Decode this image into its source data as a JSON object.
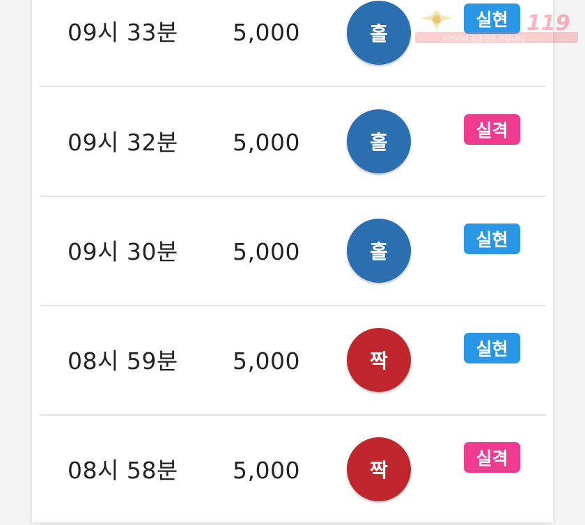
{
  "rows": [
    {
      "time": "09시 33분",
      "amount": "5,000",
      "result": "홀",
      "result_type": "odd",
      "status": "실현",
      "status_type": "hit"
    },
    {
      "time": "09시 32분",
      "amount": "5,000",
      "result": "홀",
      "result_type": "odd",
      "status": "실격",
      "status_type": "miss"
    },
    {
      "time": "09시 30분",
      "amount": "5,000",
      "result": "홀",
      "result_type": "odd",
      "status": "실현",
      "status_type": "hit"
    },
    {
      "time": "08시 59분",
      "amount": "5,000",
      "result": "짝",
      "result_type": "even",
      "status": "실현",
      "status_type": "hit"
    },
    {
      "time": "08시 58분",
      "amount": "5,000",
      "result": "짝",
      "result_type": "even",
      "status": "실격",
      "status_type": "miss"
    }
  ],
  "watermark": {
    "caption": "미진거래 검증전문 커뮤니티",
    "logo": "119"
  },
  "colors": {
    "odd": "#2c6fb0",
    "even": "#c0272d",
    "hit": "#2a97e6",
    "miss": "#ee3b8f"
  }
}
